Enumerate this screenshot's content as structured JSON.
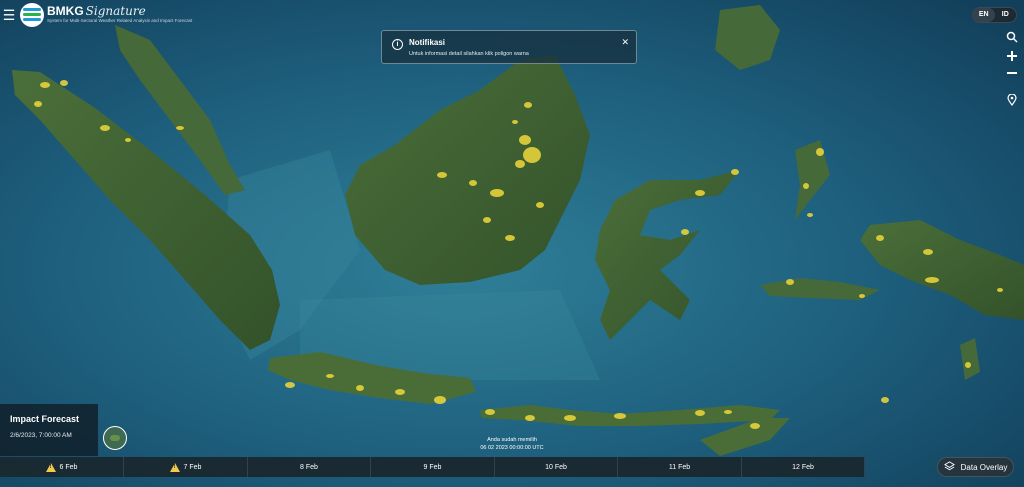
{
  "header": {
    "menu_icon": "hamburger-icon",
    "logo_text": "BMKG",
    "logo_script": "Signature",
    "subtitle": "System for Multi-Sectoral Weather Related Analysis and Impact Forecast"
  },
  "language": {
    "options": [
      "EN",
      "ID"
    ],
    "active": "EN"
  },
  "map_controls": {
    "search_icon": "search-icon",
    "zoom_in_icon": "plus-icon",
    "zoom_out_icon": "minus-icon",
    "locate_icon": "location-pin-icon"
  },
  "notification": {
    "icon": "info-icon",
    "title": "Notifikasi",
    "message": "Untuk informasi detail silahkan klik poligon warna",
    "close_icon": "close-icon"
  },
  "forecast": {
    "title": "Impact Forecast",
    "datetime": "2/6/2023, 7:00:00 AM"
  },
  "selected": {
    "line1": "Anda sudah memilih",
    "line2": "06 02 2023 00:00:00 UTC"
  },
  "timeline": {
    "days": [
      {
        "label": "6 Feb",
        "warning": true
      },
      {
        "label": "7 Feb",
        "warning": true
      },
      {
        "label": "8 Feb",
        "warning": false
      },
      {
        "label": "9 Feb",
        "warning": false
      },
      {
        "label": "10 Feb",
        "warning": false
      },
      {
        "label": "11 Feb",
        "warning": false
      },
      {
        "label": "12 Feb",
        "warning": false
      }
    ]
  },
  "data_overlay": {
    "label": "Data Overlay",
    "icon": "layers-icon"
  },
  "colors": {
    "ocean": "#1d5e7c",
    "deep_ocean": "#123f5a",
    "land": "#3e6232",
    "impact_polygon": "#e6d23a",
    "warning": "#f2c94c"
  }
}
